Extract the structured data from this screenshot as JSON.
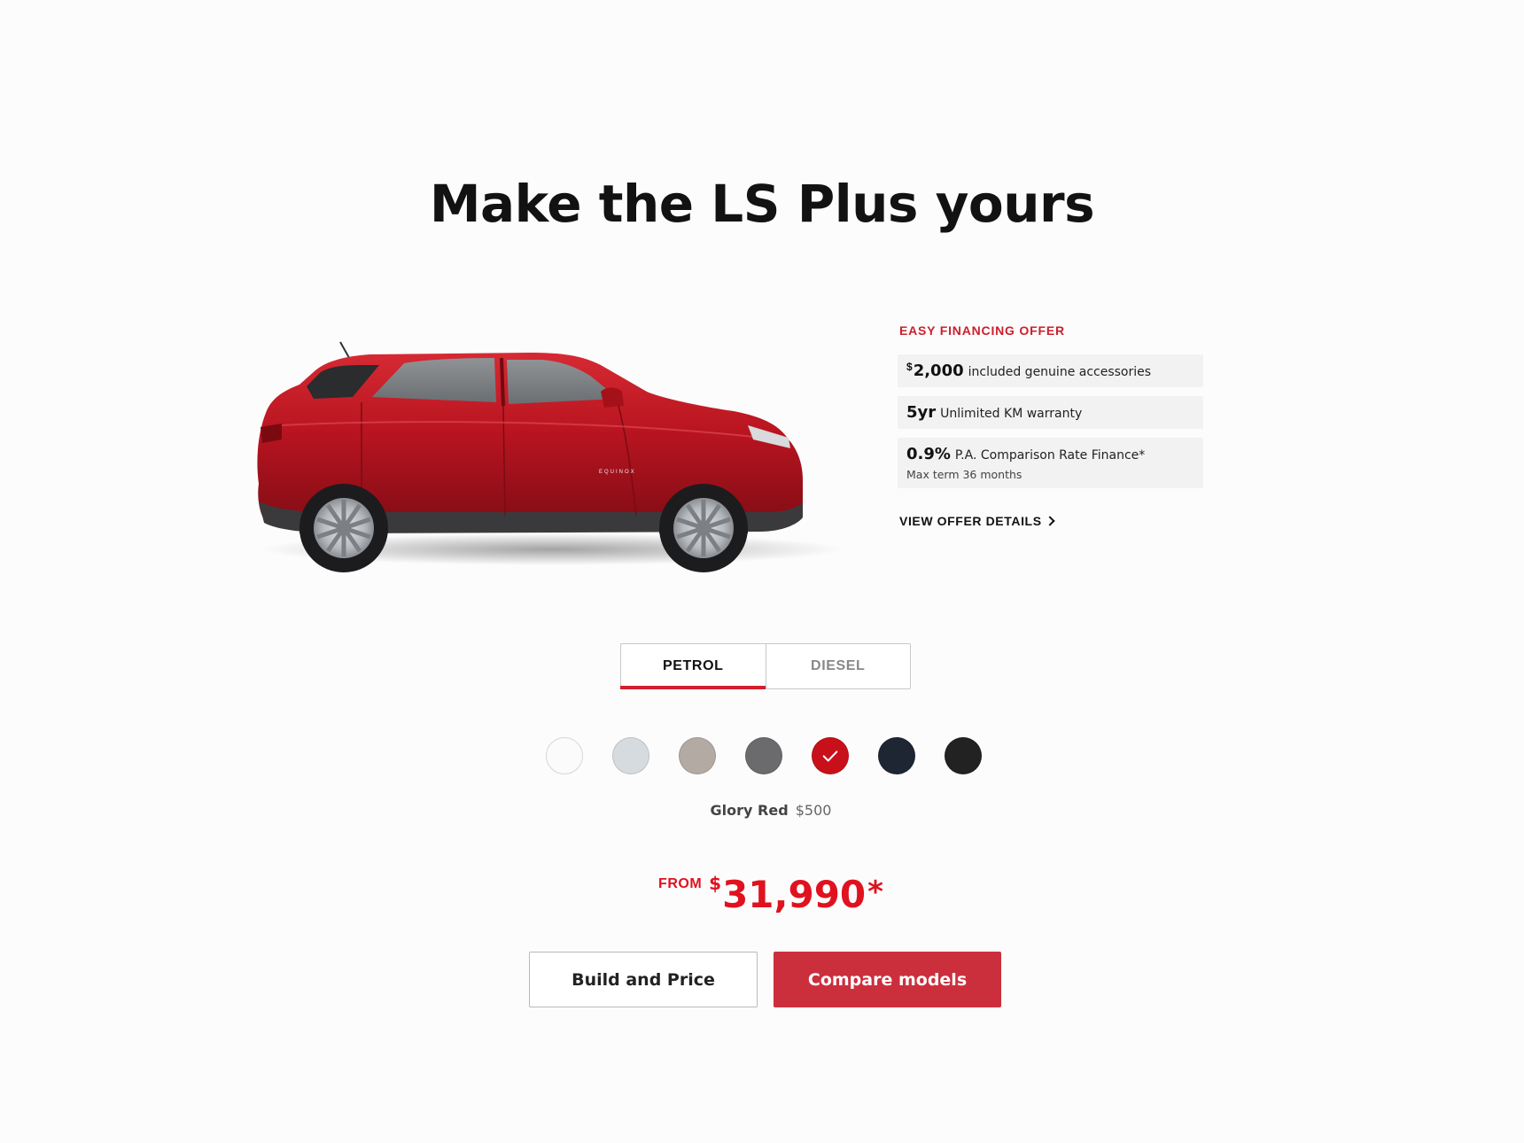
{
  "page": {
    "title": "Make the LS Plus yours"
  },
  "car": {
    "alt": "EQUINOX",
    "badge": "EQUINOX",
    "body_color": "#b81420"
  },
  "offer": {
    "heading": "EASY FINANCING OFFER",
    "items": [
      {
        "currency": "$",
        "value": "2,000",
        "text": "included genuine accessories"
      },
      {
        "value": "5yr",
        "text": "Unlimited KM warranty"
      },
      {
        "value": "0.9%",
        "text": "P.A. Comparison Rate Finance*",
        "subtext": "Max term 36 months"
      }
    ],
    "link_label": "VIEW OFFER DETAILS"
  },
  "fuel_tabs": {
    "active": "PETROL",
    "items": [
      {
        "label": "PETROL"
      },
      {
        "label": "DIESEL"
      }
    ]
  },
  "colors": {
    "selected_index": 4,
    "swatches": [
      {
        "hex": "#fbfbfb",
        "icon": ""
      },
      {
        "hex": "#d6dbe0",
        "icon": ""
      },
      {
        "hex": "#b4aaa4",
        "icon": ""
      },
      {
        "hex": "#6b6b6d",
        "icon": ""
      },
      {
        "hex": "#c8101a",
        "icon": "check-icon"
      },
      {
        "hex": "#1e2634",
        "icon": ""
      },
      {
        "hex": "#222222",
        "icon": ""
      }
    ],
    "selected_name": "Glory Red",
    "selected_price": "$500"
  },
  "price": {
    "from_label": "FROM",
    "currency": "$",
    "amount": "31,990",
    "asterisk": "*"
  },
  "buttons": {
    "build_label": "Build and Price",
    "compare_label": "Compare models"
  },
  "theme": {
    "accent": "#d21f2c",
    "button_primary": "#cc2f3c",
    "price_red": "#e0121f"
  }
}
